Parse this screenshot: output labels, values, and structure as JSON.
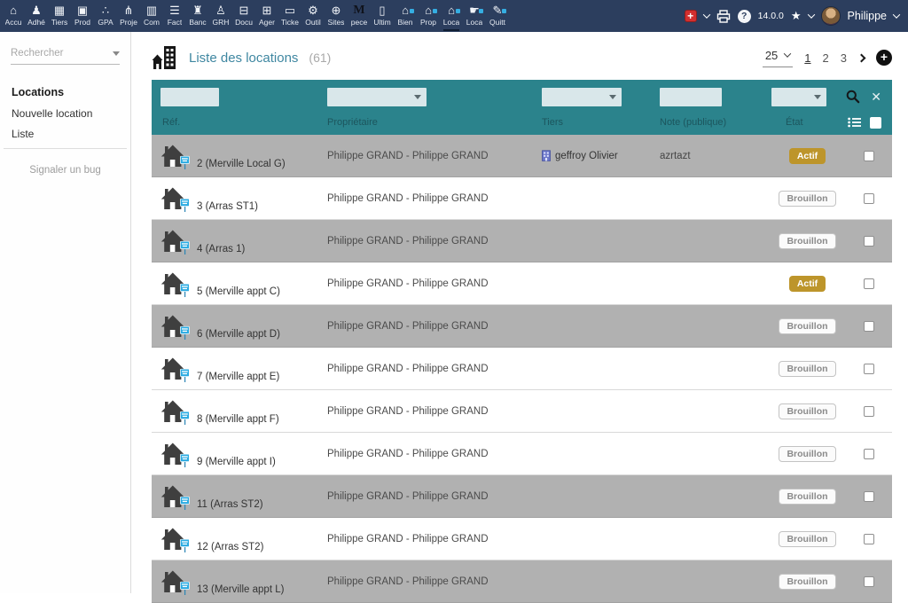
{
  "nav": {
    "items": [
      {
        "id": "accueil",
        "label": "Accu",
        "icon": "home-icon",
        "glyph": "⌂"
      },
      {
        "id": "adherents",
        "label": "Adhé",
        "icon": "members-icon",
        "glyph": "♟"
      },
      {
        "id": "tiers",
        "label": "Tiers",
        "icon": "thirdparties-icon",
        "glyph": "▦"
      },
      {
        "id": "produits",
        "label": "Prod",
        "icon": "products-icon",
        "glyph": "▣"
      },
      {
        "id": "gpa",
        "label": "GPA",
        "icon": "gpa-icon",
        "glyph": "∴"
      },
      {
        "id": "projets",
        "label": "Proje",
        "icon": "projects-icon",
        "glyph": "⋔"
      },
      {
        "id": "commerce",
        "label": "Com",
        "icon": "briefcase-icon",
        "glyph": "▥"
      },
      {
        "id": "facturation",
        "label": "Fact",
        "icon": "billing-icon",
        "glyph": "☰"
      },
      {
        "id": "banque",
        "label": "Banc",
        "icon": "bank-icon",
        "glyph": "♜"
      },
      {
        "id": "grh",
        "label": "GRH",
        "icon": "hr-icon",
        "glyph": "♙"
      },
      {
        "id": "documents",
        "label": "Docu",
        "icon": "folder-icon",
        "glyph": "⊟"
      },
      {
        "id": "agenda",
        "label": "Ager",
        "icon": "calendar-icon",
        "glyph": "⊞"
      },
      {
        "id": "tickets",
        "label": "Ticke",
        "icon": "ticket-icon",
        "glyph": "▭"
      },
      {
        "id": "outils",
        "label": "Outil",
        "icon": "tools-icon",
        "glyph": "⚙"
      },
      {
        "id": "sites",
        "label": "Sites",
        "icon": "globe-icon",
        "glyph": "⊕"
      },
      {
        "id": "pece",
        "label": "pece",
        "icon": "m-module-icon",
        "glyph": "M",
        "dark": true
      },
      {
        "id": "ultimate",
        "label": "Ultim",
        "icon": "document-icon",
        "glyph": "▯"
      },
      {
        "id": "biens",
        "label": "Bien",
        "icon": "property-search-icon",
        "glyph": "⌂",
        "accent": true
      },
      {
        "id": "proprietes",
        "label": "Prop",
        "icon": "property-icon",
        "glyph": "⌂",
        "accent": true
      },
      {
        "id": "locations",
        "label": "Loca",
        "icon": "rentals-icon",
        "glyph": "⌂",
        "accent": true,
        "active": true
      },
      {
        "id": "locataires",
        "label": "Loca",
        "icon": "tenants-icon",
        "glyph": "☛",
        "accent": true
      },
      {
        "id": "quittances",
        "label": "Quitt",
        "icon": "receipt-edit-icon",
        "glyph": "✎",
        "accent": true
      }
    ],
    "right": {
      "version": "14.0.0",
      "user": "Philippe"
    }
  },
  "sidebar": {
    "search_placeholder": "Rechercher",
    "section_title": "Locations",
    "links": [
      {
        "label": "Nouvelle location"
      },
      {
        "label": "Liste"
      }
    ],
    "bug_link": "Signaler un bug"
  },
  "header": {
    "title": "Liste des locations",
    "count_label": "(61)"
  },
  "pagination": {
    "page_size": "25",
    "pages": [
      "1",
      "2",
      "3"
    ],
    "current_page": "1"
  },
  "table": {
    "columns": [
      "Réf.",
      "Propriétaire",
      "Tiers",
      "Note (publique)",
      "État"
    ],
    "rows": [
      {
        "ref": "2 (Merville Local G)",
        "owner": "Philippe GRAND - Philippe GRAND",
        "tiers": "geffroy Olivier",
        "note": "azrtazt",
        "status": "Actif",
        "status_type": "actif",
        "shaded": true
      },
      {
        "ref": "3 (Arras ST1)",
        "owner": "Philippe GRAND - Philippe GRAND",
        "tiers": "",
        "note": "",
        "status": "Brouillon",
        "status_type": "brouillon",
        "shaded": false
      },
      {
        "ref": "4 (Arras 1)",
        "owner": "Philippe GRAND - Philippe GRAND",
        "tiers": "",
        "note": "",
        "status": "Brouillon",
        "status_type": "brouillon",
        "shaded": true
      },
      {
        "ref": "5 (Merville appt C)",
        "owner": "Philippe GRAND - Philippe GRAND",
        "tiers": "",
        "note": "",
        "status": "Actif",
        "status_type": "actif",
        "shaded": false
      },
      {
        "ref": "6 (Merville appt D)",
        "owner": "Philippe GRAND - Philippe GRAND",
        "tiers": "",
        "note": "",
        "status": "Brouillon",
        "status_type": "brouillon",
        "shaded": true
      },
      {
        "ref": "7 (Merville appt E)",
        "owner": "Philippe GRAND - Philippe GRAND",
        "tiers": "",
        "note": "",
        "status": "Brouillon",
        "status_type": "brouillon",
        "shaded": false
      },
      {
        "ref": "8 (Merville appt F)",
        "owner": "Philippe GRAND - Philippe GRAND",
        "tiers": "",
        "note": "",
        "status": "Brouillon",
        "status_type": "brouillon",
        "shaded": false
      },
      {
        "ref": "9 (Merville appt I)",
        "owner": "Philippe GRAND - Philippe GRAND",
        "tiers": "",
        "note": "",
        "status": "Brouillon",
        "status_type": "brouillon",
        "shaded": false
      },
      {
        "ref": "11 (Arras ST2)",
        "owner": "Philippe GRAND - Philippe GRAND",
        "tiers": "",
        "note": "",
        "status": "Brouillon",
        "status_type": "brouillon",
        "shaded": true
      },
      {
        "ref": "12 (Arras ST2)",
        "owner": "Philippe GRAND - Philippe GRAND",
        "tiers": "",
        "note": "",
        "status": "Brouillon",
        "status_type": "brouillon",
        "shaded": false
      },
      {
        "ref": "13 (Merville appt L)",
        "owner": "Philippe GRAND - Philippe GRAND",
        "tiers": "",
        "note": "",
        "status": "Brouillon",
        "status_type": "brouillon",
        "shaded": true
      }
    ]
  },
  "colors": {
    "navbar": "#2c3e5e",
    "table_header": "#2b838c",
    "status_actif": "#bd952b",
    "row_shaded": "#b1b1b1"
  }
}
